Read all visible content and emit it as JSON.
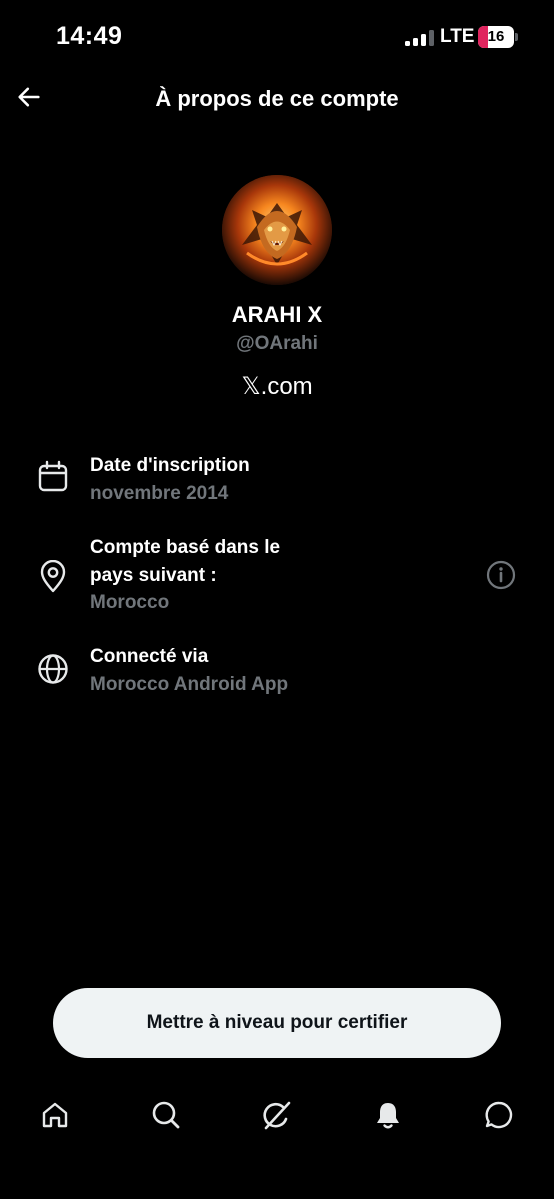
{
  "status_bar": {
    "time": "14:49",
    "network": "LTE",
    "battery": "16",
    "battery_level_percent": 16
  },
  "header": {
    "title": "À propos de ce compte",
    "back_icon": "arrow-left-icon"
  },
  "profile": {
    "avatar_icon": "lion-avatar",
    "display_name": "ARAHI X",
    "handle": "@OArahi",
    "site": "𝕏.com"
  },
  "info": [
    {
      "icon": "calendar-icon",
      "title_lines": [
        "Date d'inscription"
      ],
      "value": "novembre 2014"
    },
    {
      "icon": "location-pin-icon",
      "title_lines": [
        "Compte basé dans le",
        "pays suivant :"
      ],
      "value": "Morocco",
      "action_icon": "info-icon"
    },
    {
      "icon": "globe-icon",
      "title_lines": [
        "Connecté via"
      ],
      "value": "Morocco Android App"
    }
  ],
  "upgrade_button": {
    "label": "Mettre à niveau pour certifier"
  },
  "bottom_nav": {
    "items": [
      "home-icon",
      "search-icon",
      "grok-icon",
      "notifications-icon",
      "messages-icon"
    ]
  },
  "colors": {
    "background": "#000000",
    "primary_text": "#ffffff",
    "secondary_text": "#71767b",
    "button_background": "#eff3f4",
    "battery_low": "#e0245e"
  }
}
